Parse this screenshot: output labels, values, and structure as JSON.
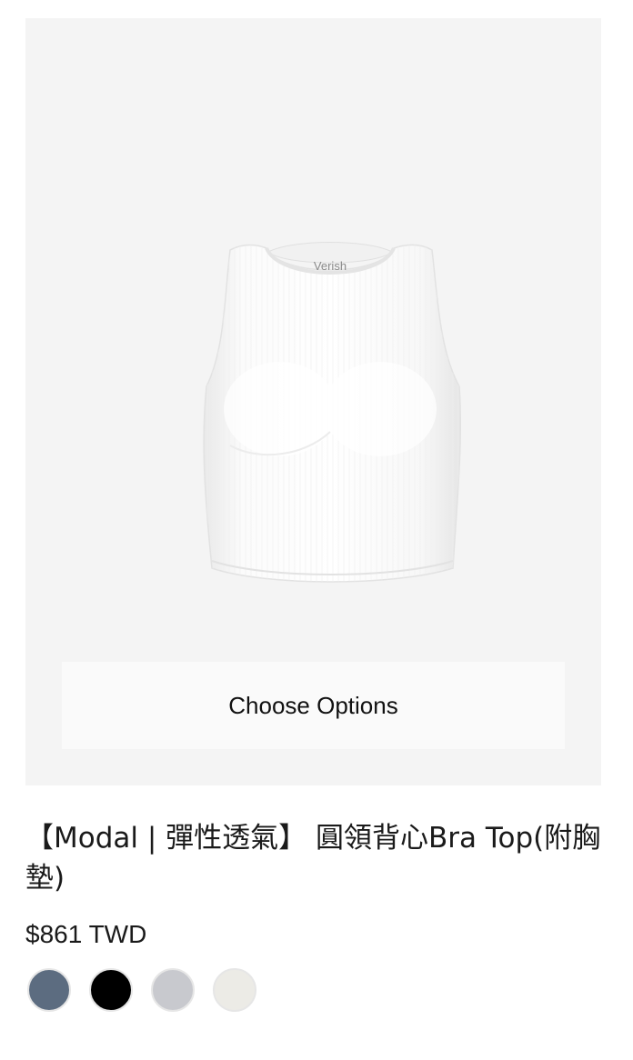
{
  "product": {
    "image_alt": "White ribbed cropped tank bra top",
    "image_brand_tag": "Verish",
    "choose_options_label": "Choose Options",
    "title": "【Modal | 彈性透氣】 圓領背心Bra Top(附胸墊)",
    "price": "$861 TWD"
  },
  "swatches": [
    {
      "name": "slate-blue",
      "color": "#5c6c80"
    },
    {
      "name": "black",
      "color": "#000000"
    },
    {
      "name": "light-gray",
      "color": "#c8c9ce"
    },
    {
      "name": "ivory",
      "color": "#ecebe6"
    }
  ],
  "colors": {
    "media_background": "#f4f4f4",
    "button_background": "#fafafa"
  }
}
